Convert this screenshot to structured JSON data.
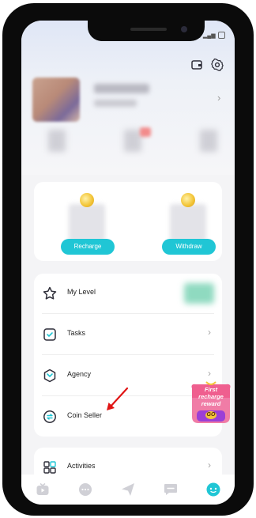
{
  "colors": {
    "accent": "#20c6d5",
    "icon_stroke": "#2f2f3a",
    "chevron": "#a5a5a5",
    "tab_inactive": "#d0d0d6",
    "badge_gold": "#f3c63a"
  },
  "header": {
    "wallet_icon": "wallet-icon",
    "settings_icon": "gear-icon"
  },
  "wallet": {
    "recharge_label": "Recharge",
    "withdraw_label": "Withdraw"
  },
  "menu": {
    "items": [
      {
        "label": "My Level",
        "icon": "star-icon"
      },
      {
        "label": "Tasks",
        "icon": "tasks-icon"
      },
      {
        "label": "Agency",
        "icon": "agency-icon"
      },
      {
        "label": "Coin Seller",
        "icon": "coin-seller-icon"
      }
    ]
  },
  "activities": {
    "label": "Activities",
    "icon": "grid-icon"
  },
  "promo": {
    "line1": "First",
    "line2": "recharge",
    "line3": "reward",
    "line4": "GO"
  },
  "tabs": [
    {
      "icon": "tv-icon",
      "active": false
    },
    {
      "icon": "chat-bubbles-icon",
      "active": false
    },
    {
      "icon": "send-icon",
      "active": false
    },
    {
      "icon": "message-icon",
      "active": false
    },
    {
      "icon": "profile-icon",
      "active": true
    }
  ]
}
